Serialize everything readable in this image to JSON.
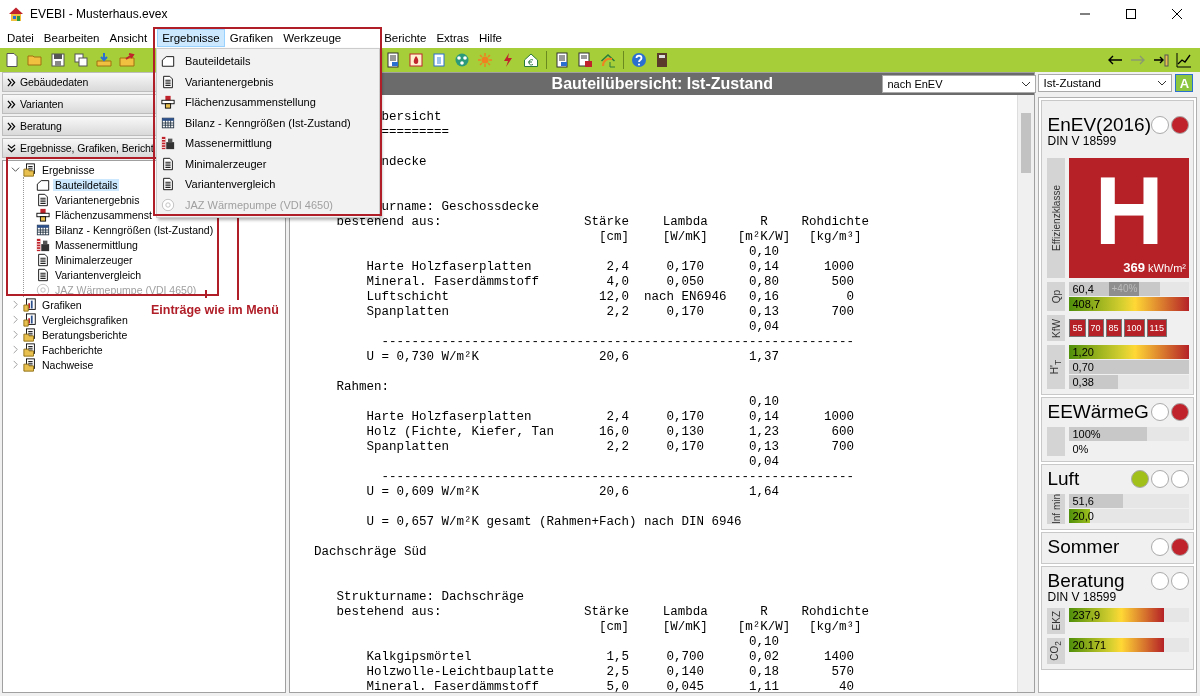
{
  "window": {
    "title": "EVEBI - Musterhaus.evex"
  },
  "menu_bar": [
    {
      "label": "Datei",
      "selected": false
    },
    {
      "label": "Bearbeiten",
      "selected": false
    },
    {
      "label": "Ansicht",
      "selected": false
    },
    {
      "label": "Ergebnisse",
      "selected": true
    },
    {
      "label": "Grafiken",
      "selected": false
    },
    {
      "label": "Werkzeuge",
      "selected": false
    },
    {
      "label": "Berichte",
      "selected": false
    },
    {
      "label": "Extras",
      "selected": false
    },
    {
      "label": "Hilfe",
      "selected": false
    }
  ],
  "open_menu": [
    {
      "label": "Bauteildetails",
      "disabled": false
    },
    {
      "label": "Variantenergebnis",
      "disabled": false
    },
    {
      "label": "Flächenzusammenstellung",
      "disabled": false
    },
    {
      "label": "Bilanz - Kenngrößen (Ist-Zustand)",
      "disabled": false
    },
    {
      "label": "Massenermittlung",
      "disabled": false
    },
    {
      "label": "Minimalerzeuger",
      "disabled": false
    },
    {
      "label": "Variantenvergleich",
      "disabled": false
    },
    {
      "label": "JAZ Wärmepumpe (VDI 4650)",
      "disabled": true
    }
  ],
  "toolbar": {
    "forward_disabled": true
  },
  "sidebar": {
    "sections": [
      {
        "label": "Gebäudedaten",
        "expanded": false
      },
      {
        "label": "Varianten",
        "expanded": false
      },
      {
        "label": "Beratung",
        "expanded": false
      },
      {
        "label": "Ergebnisse, Grafiken, Bericht",
        "expanded": true
      }
    ],
    "tree": [
      {
        "label": "Ergebnisse",
        "expanded": true,
        "children": [
          {
            "label": "Bauteildetails",
            "selected": true,
            "disabled": false
          },
          {
            "label": "Variantenergebnis",
            "selected": false,
            "disabled": false
          },
          {
            "label": "Flächenzusammenst",
            "selected": false,
            "disabled": false
          },
          {
            "label": "Bilanz - Kenngrößen (Ist-Zustand)",
            "selected": false,
            "disabled": false
          },
          {
            "label": "Massenermittlung",
            "selected": false,
            "disabled": false
          },
          {
            "label": "Minimalerzeuger",
            "selected": false,
            "disabled": false
          },
          {
            "label": "Variantenvergleich",
            "selected": false,
            "disabled": false
          },
          {
            "label": "JAZ Wärmepumpe (VDI 4650)",
            "selected": false,
            "disabled": true
          }
        ]
      },
      {
        "label": "Grafiken",
        "expanded": false
      },
      {
        "label": "Vergleichsgrafiken",
        "expanded": false
      },
      {
        "label": "Beratungsberichte",
        "expanded": false
      },
      {
        "label": "Fachberichte",
        "expanded": false
      },
      {
        "label": "Nachweise",
        "expanded": false
      }
    ]
  },
  "annotation": {
    "label": "Einträge wie im Menü"
  },
  "report": {
    "title": "Bauteilübersicht: Ist-Zustand",
    "norm_select": "nach EnEV",
    "lines": [
      {
        "kind": "cut",
        "text": "bersicht"
      },
      {
        "kind": "cut",
        "text": "========="
      },
      {
        "kind": "blank"
      },
      {
        "kind": "cut",
        "text": "ndecke"
      },
      {
        "kind": "blank"
      },
      {
        "kind": "blank"
      },
      {
        "kind": "cut",
        "text": "urname: Geschossdecke"
      },
      {
        "kind": "header",
        "cells": [
          "bestehend aus:",
          "Stärke",
          "Lambda",
          "R",
          "Rohdichte"
        ]
      },
      {
        "kind": "units",
        "cells": [
          "[cm]",
          "[W/mK]",
          "[m²K/W]",
          "[kg/m³]"
        ]
      },
      {
        "kind": "resistance",
        "text": "0,10"
      },
      {
        "kind": "layer",
        "cells": [
          "Harte Holzfaserplatten",
          "2,4",
          "0,170",
          "0,14",
          "1000"
        ]
      },
      {
        "kind": "layer",
        "cells": [
          "Mineral. Faserdämmstoff",
          "4,0",
          "0,050",
          "0,80",
          "500"
        ]
      },
      {
        "kind": "layer",
        "cells": [
          "Luftschicht",
          "12,0",
          "nach EN6946",
          "0,16",
          "0"
        ]
      },
      {
        "kind": "layer",
        "cells": [
          "Spanplatten",
          "2,2",
          "0,170",
          "0,13",
          "700"
        ]
      },
      {
        "kind": "resistance",
        "text": "0,04"
      },
      {
        "kind": "rule",
        "text": "---------------------------------------------------------------"
      },
      {
        "kind": "total",
        "cells": [
          "U = 0,730 W/m²K",
          "20,6",
          "1,37"
        ]
      },
      {
        "kind": "blank"
      },
      {
        "kind": "label",
        "text": "Rahmen:"
      },
      {
        "kind": "resistance",
        "text": "0,10"
      },
      {
        "kind": "layer",
        "cells": [
          "Harte Holzfaserplatten",
          "2,4",
          "0,170",
          "0,14",
          "1000"
        ]
      },
      {
        "kind": "layer",
        "cells": [
          "Holz (Fichte, Kiefer, Tan",
          "16,0",
          "0,130",
          "1,23",
          "600"
        ]
      },
      {
        "kind": "layer",
        "cells": [
          "Spanplatten",
          "2,2",
          "0,170",
          "0,13",
          "700"
        ]
      },
      {
        "kind": "resistance",
        "text": "0,04"
      },
      {
        "kind": "rule",
        "text": "---------------------------------------------------------------"
      },
      {
        "kind": "total",
        "cells": [
          "U = 0,609 W/m²K",
          "20,6",
          "1,64"
        ]
      },
      {
        "kind": "blank"
      },
      {
        "kind": "note",
        "text": "U = 0,657 W/m²K gesamt (Rahmen+Fach) nach DIN 6946"
      },
      {
        "kind": "blank"
      },
      {
        "kind": "title",
        "text": "Dachschräge Süd"
      },
      {
        "kind": "blank"
      },
      {
        "kind": "blank"
      },
      {
        "kind": "label",
        "text": "Strukturname: Dachschräge"
      },
      {
        "kind": "header",
        "cells": [
          "bestehend aus:",
          "Stärke",
          "Lambda",
          "R",
          "Rohdichte"
        ]
      },
      {
        "kind": "units",
        "cells": [
          "[cm]",
          "[W/mK]",
          "[m²K/W]",
          "[kg/m³]"
        ]
      },
      {
        "kind": "resistance",
        "text": "0,10"
      },
      {
        "kind": "layer",
        "cells": [
          "Kalkgipsmörtel",
          "1,5",
          "0,700",
          "0,02",
          "1400"
        ]
      },
      {
        "kind": "layer",
        "cells": [
          "Holzwolle-Leichtbauplatte",
          "2,5",
          "0,140",
          "0,18",
          "570"
        ]
      },
      {
        "kind": "layer",
        "cells": [
          "Mineral. Faserdämmstoff",
          "5,0",
          "0,045",
          "1,11",
          "40"
        ]
      }
    ]
  },
  "panel": {
    "variant_select": "Ist-Zustand",
    "badge": "A",
    "sections": [
      {
        "title": "EnEV(2016)",
        "subtitle": "DIN V 18599",
        "lights": [
          {
            "color": "#ffffff"
          },
          {
            "color": "#c0232b"
          }
        ],
        "blocks": [
          {
            "kind": "class",
            "label": "Effizienzklasse",
            "letter": "H",
            "value": "369",
            "unit": "kWh/m²"
          },
          {
            "kind": "bars",
            "label": "Qp",
            "bars": [
              {
                "kind": "grey",
                "text": "60,4",
                "level": 0.76,
                "flag": "+40%"
              },
              {
                "kind": "gradient",
                "text": "408,7",
                "level": 1
              }
            ]
          },
          {
            "kind": "kfw",
            "label": "KfW",
            "values": [
              "55",
              "70",
              "85",
              "100",
              "115"
            ]
          },
          {
            "kind": "bars",
            "label": "H'$_{T}$",
            "bars": [
              {
                "kind": "gradient",
                "text": "1,20",
                "level": 1
              },
              {
                "kind": "grey",
                "text": "0,70",
                "level": 1
              },
              {
                "kind": "grey",
                "text": "0,38",
                "level": 0.41
              }
            ]
          }
        ]
      },
      {
        "title": "EEWärmeG",
        "lights": [
          {
            "color": "#ffffff"
          },
          {
            "color": "#c0232b"
          }
        ],
        "blocks": [
          {
            "kind": "bars",
            "bars": [
              {
                "kind": "grey",
                "text": "100%",
                "level": 0.65
              },
              {
                "text": "0%"
              }
            ]
          }
        ]
      },
      {
        "title": "Luft",
        "lights": [
          {
            "color": "#a2c01a"
          },
          {
            "color": "#ffffff"
          },
          {
            "color": "#ffffff"
          }
        ],
        "blocks": [
          {
            "kind": "bars",
            "label": "Inf min",
            "bars": [
              {
                "kind": "grey",
                "text": "51,6",
                "level": 0.45
              },
              {
                "kind": "green",
                "text": "20,0",
                "level": 0.17
              }
            ]
          }
        ]
      },
      {
        "title": "Sommer",
        "lights": [
          {
            "color": "#ffffff"
          },
          {
            "color": "#c0232b"
          }
        ]
      },
      {
        "title": "Beratung",
        "subtitle": "DIN V 18599",
        "lights": [
          {
            "color": "#ffffff"
          },
          {
            "color": "#ffffff"
          }
        ],
        "blocks": [
          {
            "kind": "bars",
            "label": "EKZ",
            "bars": [
              {
                "kind": "gradient",
                "text": "237,9",
                "level": 0.79
              }
            ]
          },
          {
            "kind": "bars",
            "label": "CO$_{2}$",
            "bars": [
              {
                "kind": "gradient",
                "text": "20.171",
                "level": 0.79
              }
            ]
          }
        ]
      }
    ]
  }
}
